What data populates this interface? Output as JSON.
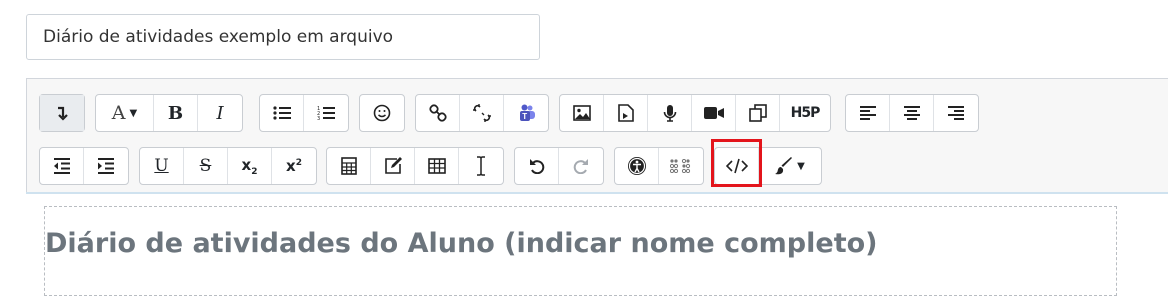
{
  "title_field": {
    "value": "Diário de atividades exemplo em arquivo"
  },
  "toolbar": {
    "row1": [
      [
        {
          "name": "collapse-button",
          "icon": "collapse-arrow-icon",
          "active": true
        }
      ],
      [
        {
          "name": "font-color-button",
          "icon": "font-color-icon",
          "label": "A"
        },
        {
          "name": "bold-button",
          "label": "B"
        },
        {
          "name": "italic-button",
          "label": "I"
        }
      ],
      [
        {
          "name": "unordered-list-button",
          "icon": "bullet-list-icon"
        },
        {
          "name": "ordered-list-button",
          "icon": "numbered-list-icon"
        }
      ],
      [
        {
          "name": "emoji-button",
          "icon": "smiley-icon"
        }
      ],
      [
        {
          "name": "link-button",
          "icon": "link-icon"
        },
        {
          "name": "unlink-button",
          "icon": "unlink-icon"
        },
        {
          "name": "teams-button",
          "icon": "teams-icon"
        }
      ],
      [
        {
          "name": "image-button",
          "icon": "image-icon"
        },
        {
          "name": "media-button",
          "icon": "media-file-icon"
        },
        {
          "name": "record-audio-button",
          "icon": "microphone-icon"
        },
        {
          "name": "record-video-button",
          "icon": "video-camera-icon"
        },
        {
          "name": "manage-files-button",
          "icon": "files-icon"
        },
        {
          "name": "h5p-button",
          "label": "H5P"
        }
      ],
      [
        {
          "name": "align-left-button",
          "icon": "align-left-icon"
        },
        {
          "name": "align-center-button",
          "icon": "align-center-icon"
        },
        {
          "name": "align-right-button",
          "icon": "align-right-icon"
        }
      ]
    ],
    "row2": [
      [
        {
          "name": "outdent-button",
          "icon": "outdent-icon"
        },
        {
          "name": "indent-button",
          "icon": "indent-icon"
        }
      ],
      [
        {
          "name": "underline-button",
          "label": "U"
        },
        {
          "name": "strikethrough-button",
          "label": "S"
        },
        {
          "name": "subscript-button",
          "label": "x",
          "sub": "2"
        },
        {
          "name": "superscript-button",
          "label": "x",
          "sup": "2"
        }
      ],
      [
        {
          "name": "equation-button",
          "icon": "calculator-icon"
        },
        {
          "name": "edit-button",
          "icon": "edit-icon"
        },
        {
          "name": "table-button",
          "icon": "table-icon"
        },
        {
          "name": "clear-formatting-button",
          "icon": "text-cursor-icon"
        }
      ],
      [
        {
          "name": "undo-button",
          "icon": "undo-icon"
        },
        {
          "name": "redo-button",
          "icon": "redo-icon",
          "disabled": true
        }
      ],
      [
        {
          "name": "accessibility-checker-button",
          "icon": "accessibility-icon"
        },
        {
          "name": "screenreader-helper-button",
          "icon": "braille-icon"
        }
      ],
      [
        {
          "name": "html-source-button",
          "icon": "code-icon"
        },
        {
          "name": "more-tools-button",
          "icon": "paintbrush-icon"
        }
      ]
    ]
  },
  "editor": {
    "heading": "Diário de atividades do Aluno (indicar nome completo)"
  },
  "colors": {
    "highlight": "#e3141b",
    "heading": "#6c757d"
  }
}
